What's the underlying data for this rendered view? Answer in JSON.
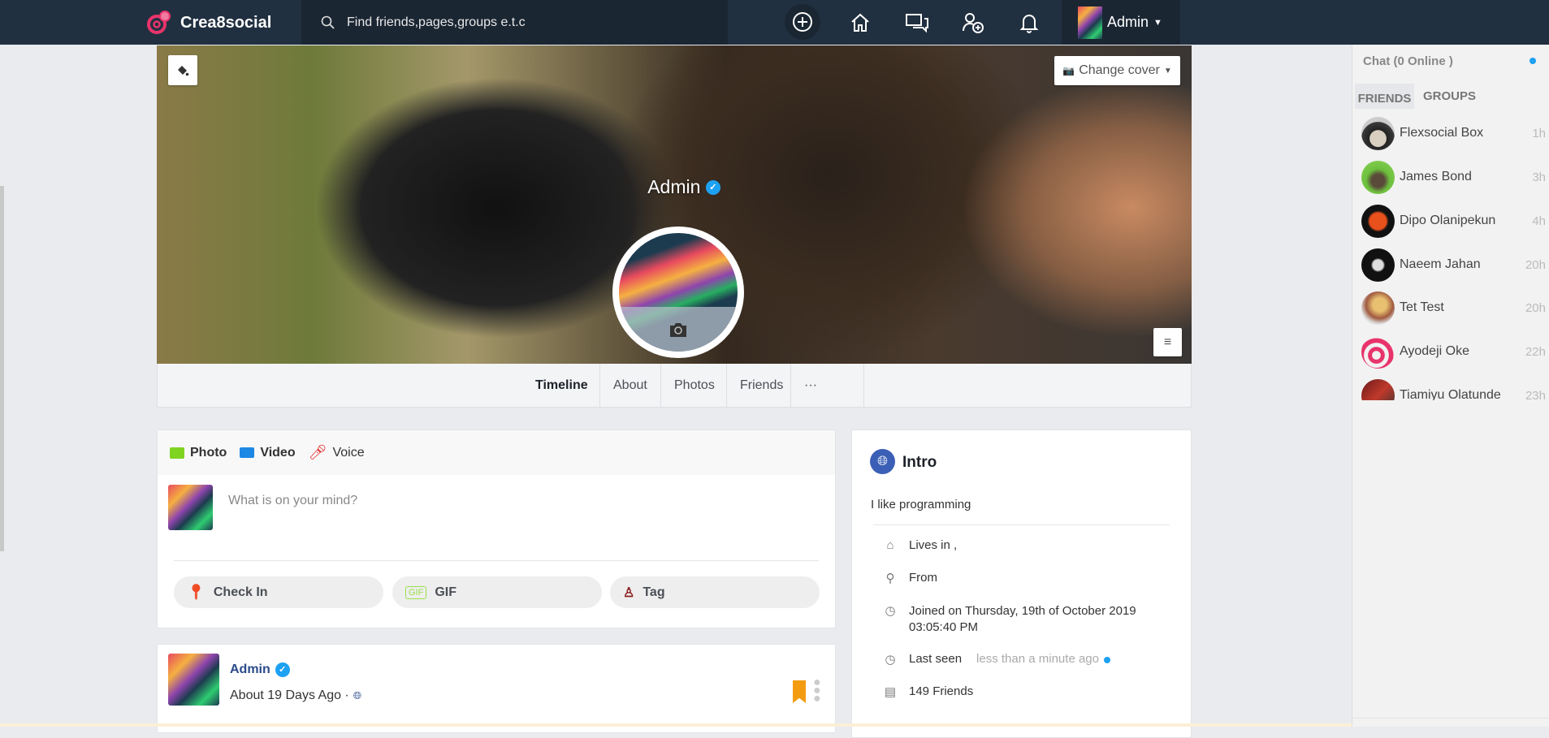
{
  "header": {
    "brand": "Crea8social",
    "search_placeholder": "Find friends,pages,groups e.t.c",
    "user_name": "Admin"
  },
  "profile": {
    "name": "Admin",
    "change_cover_label": "Change cover",
    "tabs": [
      "Timeline",
      "About",
      "Photos",
      "Friends",
      "···"
    ]
  },
  "composer": {
    "types": [
      "Photo",
      "Video",
      "Voice"
    ],
    "placeholder": "What is on your mind?",
    "actions": [
      "Check In",
      "GIF",
      "Tag"
    ],
    "gif_badge": "GIF"
  },
  "post": {
    "author": "Admin",
    "time": "About 19 Days Ago ·"
  },
  "intro": {
    "title": "Intro",
    "bio": "I like programming",
    "lives_in": "Lives in ,",
    "from": "From",
    "joined": "Joined on Thursday, 19th of October 2019",
    "joined_time": "03:05:40 PM",
    "last_seen_label": "Last seen",
    "last_seen_value": "less than a minute ago",
    "friends_count": "149 Friends"
  },
  "chat": {
    "title": "Chat (0 Online )",
    "tabs": [
      "FRIENDS",
      "GROUPS"
    ],
    "friends": [
      {
        "name": "Flexsocial Box",
        "time": "1h"
      },
      {
        "name": "James Bond",
        "time": "3h"
      },
      {
        "name": "Dipo Olanipekun",
        "time": "4h"
      },
      {
        "name": "Naeem Jahan",
        "time": "20h"
      },
      {
        "name": "Tet Test",
        "time": "20h"
      },
      {
        "name": "Ayodeji Oke",
        "time": "22h"
      },
      {
        "name": "Tiamiyu Olatunde",
        "time": "23h"
      }
    ]
  },
  "colors": {
    "header": "#213040",
    "accent": "#1da1f2",
    "link": "#2a4a8a"
  }
}
